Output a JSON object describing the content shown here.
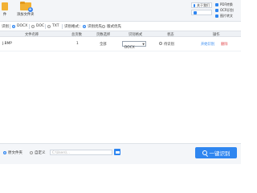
{
  "toolbar": {
    "left_btn_label": "件",
    "add_folder_label": "添加文件夹",
    "btn_help": "关于我们",
    "btn_min": "",
    "chk_1": "PDF转换",
    "chk_2": "OCR识别",
    "chk_3": "图片转文"
  },
  "format_bar": {
    "prefix": "识别",
    "formats": [
      "DOCX",
      "DOC",
      "TXT"
    ],
    "selected_format": "DOCX",
    "ocr_mode_label": "识别格式：",
    "ocr_mode_value": "识别优先",
    "layout_value": "版式优先"
  },
  "table": {
    "headers": {
      "name": "文件名称",
      "total_pages": "总页数",
      "page_select": "页数选择",
      "format": "识别格式",
      "status": "状态",
      "action": "操作"
    },
    "rows": [
      {
        "name": "J.BMP",
        "total_pages": "1",
        "page_select": "全部",
        "format": "DOCX",
        "status": "待识别",
        "action_recognize": "开始识别",
        "action_delete": "删除"
      }
    ]
  },
  "footer": {
    "source_folder_label": "原文件夹",
    "custom_label": "自定义",
    "path_placeholder": "C:\\Users\\...",
    "start_button": "一键识别"
  },
  "colors": {
    "accent": "#2f86f0",
    "folder": "#f2b134",
    "delete": "#e0454a"
  }
}
